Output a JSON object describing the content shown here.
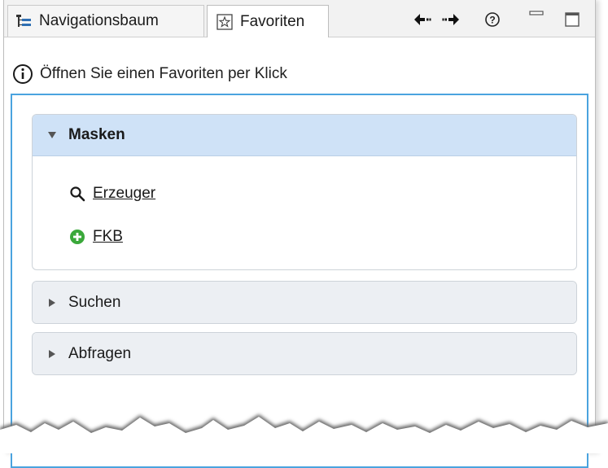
{
  "tabs": [
    {
      "label": "Navigationsbaum",
      "icon": "tree-icon",
      "active": false
    },
    {
      "label": "Favoriten",
      "icon": "star-icon",
      "active": true
    }
  ],
  "toolbar": {
    "back_icon": "arrow-left-icon",
    "forward_icon": "arrow-right-icon",
    "help_icon": "help-icon",
    "minimize_icon": "minimize-icon",
    "maximize_icon": "maximize-icon"
  },
  "hint": {
    "icon": "info-icon",
    "text": "Öffnen Sie einen Favoriten per Klick"
  },
  "sections": [
    {
      "title": "Masken",
      "expanded": true,
      "items": [
        {
          "label": "Erzeuger",
          "icon": "search-icon"
        },
        {
          "label": "FKB",
          "icon": "add-circle-icon"
        }
      ]
    },
    {
      "title": "Suchen",
      "expanded": false
    },
    {
      "title": "Abfragen",
      "expanded": false
    }
  ],
  "colors": {
    "accent_border": "#4aa3df",
    "section_header_open": "#cfe2f7",
    "section_header_closed": "#eceff3",
    "add_icon_green": "#3aa83a"
  }
}
